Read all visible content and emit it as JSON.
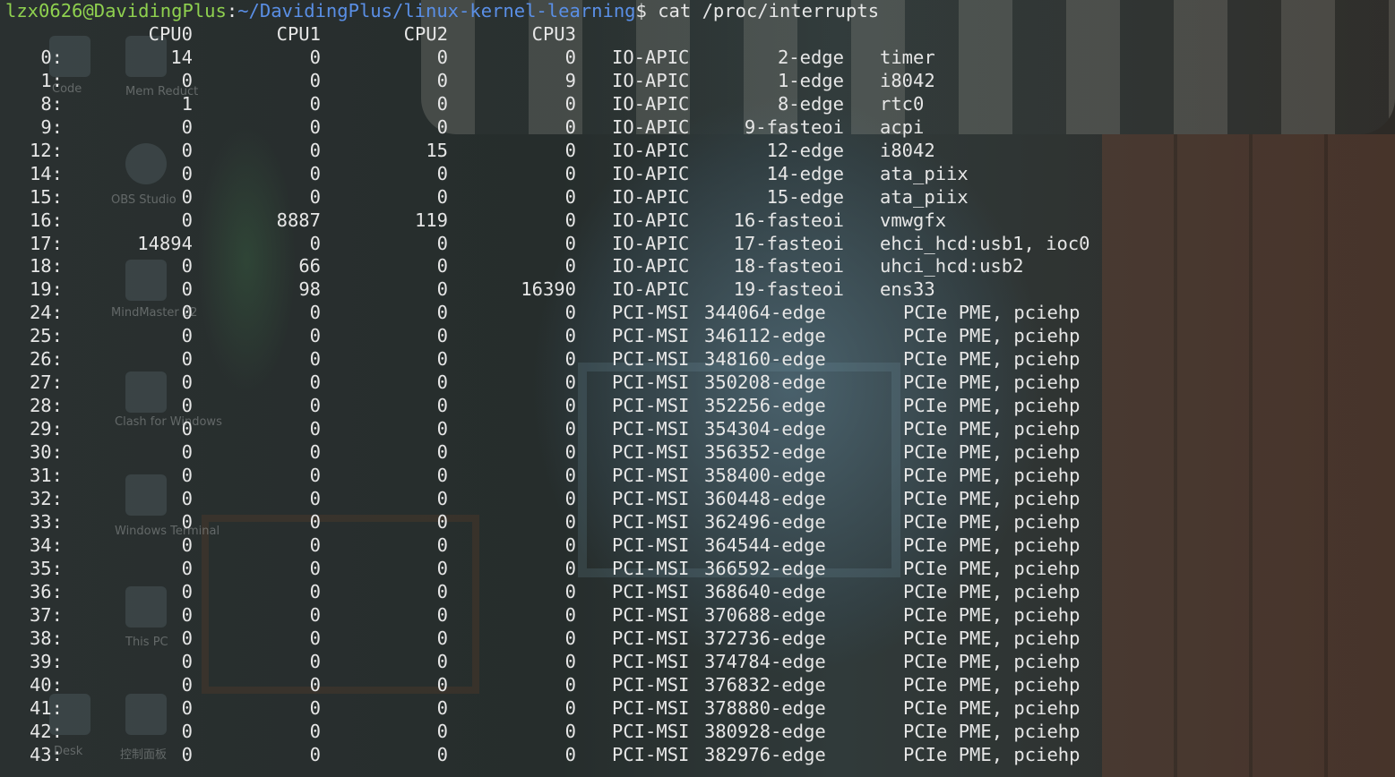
{
  "prompt": {
    "user_host": "lzx0626@DavidingPlus",
    "colon": ":",
    "path": "~/DavidingPlus/linux-kernel-learning",
    "dollar": "$",
    "command": " cat /proc/interrupts"
  },
  "header": [
    "CPU0",
    "CPU1",
    "CPU2",
    "CPU3"
  ],
  "rows": [
    {
      "irq": "0:",
      "cpu0": "14",
      "cpu1": "0",
      "cpu2": "0",
      "cpu3": "0",
      "chip": "IO-APIC",
      "type": "2-edge",
      "device": "timer"
    },
    {
      "irq": "1:",
      "cpu0": "0",
      "cpu1": "0",
      "cpu2": "0",
      "cpu3": "9",
      "chip": "IO-APIC",
      "type": "1-edge",
      "device": "i8042"
    },
    {
      "irq": "8:",
      "cpu0": "1",
      "cpu1": "0",
      "cpu2": "0",
      "cpu3": "0",
      "chip": "IO-APIC",
      "type": "8-edge",
      "device": "rtc0"
    },
    {
      "irq": "9:",
      "cpu0": "0",
      "cpu1": "0",
      "cpu2": "0",
      "cpu3": "0",
      "chip": "IO-APIC",
      "type": "9-fasteoi",
      "device": "acpi"
    },
    {
      "irq": "12:",
      "cpu0": "0",
      "cpu1": "0",
      "cpu2": "15",
      "cpu3": "0",
      "chip": "IO-APIC",
      "type": "12-edge",
      "device": "i8042"
    },
    {
      "irq": "14:",
      "cpu0": "0",
      "cpu1": "0",
      "cpu2": "0",
      "cpu3": "0",
      "chip": "IO-APIC",
      "type": "14-edge",
      "device": "ata_piix"
    },
    {
      "irq": "15:",
      "cpu0": "0",
      "cpu1": "0",
      "cpu2": "0",
      "cpu3": "0",
      "chip": "IO-APIC",
      "type": "15-edge",
      "device": "ata_piix"
    },
    {
      "irq": "16:",
      "cpu0": "0",
      "cpu1": "8887",
      "cpu2": "119",
      "cpu3": "0",
      "chip": "IO-APIC",
      "type": "16-fasteoi",
      "device": "vmwgfx"
    },
    {
      "irq": "17:",
      "cpu0": "14894",
      "cpu1": "0",
      "cpu2": "0",
      "cpu3": "0",
      "chip": "IO-APIC",
      "type": "17-fasteoi",
      "device": "ehci_hcd:usb1, ioc0"
    },
    {
      "irq": "18:",
      "cpu0": "0",
      "cpu1": "66",
      "cpu2": "0",
      "cpu3": "0",
      "chip": "IO-APIC",
      "type": "18-fasteoi",
      "device": "uhci_hcd:usb2"
    },
    {
      "irq": "19:",
      "cpu0": "0",
      "cpu1": "98",
      "cpu2": "0",
      "cpu3": "16390",
      "chip": "IO-APIC",
      "type": "19-fasteoi",
      "device": "ens33"
    },
    {
      "irq": "24:",
      "cpu0": "0",
      "cpu1": "0",
      "cpu2": "0",
      "cpu3": "0",
      "chip": "PCI-MSI",
      "type": "344064-edge",
      "device": "PCIe PME, pciehp"
    },
    {
      "irq": "25:",
      "cpu0": "0",
      "cpu1": "0",
      "cpu2": "0",
      "cpu3": "0",
      "chip": "PCI-MSI",
      "type": "346112-edge",
      "device": "PCIe PME, pciehp"
    },
    {
      "irq": "26:",
      "cpu0": "0",
      "cpu1": "0",
      "cpu2": "0",
      "cpu3": "0",
      "chip": "PCI-MSI",
      "type": "348160-edge",
      "device": "PCIe PME, pciehp"
    },
    {
      "irq": "27:",
      "cpu0": "0",
      "cpu1": "0",
      "cpu2": "0",
      "cpu3": "0",
      "chip": "PCI-MSI",
      "type": "350208-edge",
      "device": "PCIe PME, pciehp"
    },
    {
      "irq": "28:",
      "cpu0": "0",
      "cpu1": "0",
      "cpu2": "0",
      "cpu3": "0",
      "chip": "PCI-MSI",
      "type": "352256-edge",
      "device": "PCIe PME, pciehp"
    },
    {
      "irq": "29:",
      "cpu0": "0",
      "cpu1": "0",
      "cpu2": "0",
      "cpu3": "0",
      "chip": "PCI-MSI",
      "type": "354304-edge",
      "device": "PCIe PME, pciehp"
    },
    {
      "irq": "30:",
      "cpu0": "0",
      "cpu1": "0",
      "cpu2": "0",
      "cpu3": "0",
      "chip": "PCI-MSI",
      "type": "356352-edge",
      "device": "PCIe PME, pciehp"
    },
    {
      "irq": "31:",
      "cpu0": "0",
      "cpu1": "0",
      "cpu2": "0",
      "cpu3": "0",
      "chip": "PCI-MSI",
      "type": "358400-edge",
      "device": "PCIe PME, pciehp"
    },
    {
      "irq": "32:",
      "cpu0": "0",
      "cpu1": "0",
      "cpu2": "0",
      "cpu3": "0",
      "chip": "PCI-MSI",
      "type": "360448-edge",
      "device": "PCIe PME, pciehp"
    },
    {
      "irq": "33:",
      "cpu0": "0",
      "cpu1": "0",
      "cpu2": "0",
      "cpu3": "0",
      "chip": "PCI-MSI",
      "type": "362496-edge",
      "device": "PCIe PME, pciehp"
    },
    {
      "irq": "34:",
      "cpu0": "0",
      "cpu1": "0",
      "cpu2": "0",
      "cpu3": "0",
      "chip": "PCI-MSI",
      "type": "364544-edge",
      "device": "PCIe PME, pciehp"
    },
    {
      "irq": "35:",
      "cpu0": "0",
      "cpu1": "0",
      "cpu2": "0",
      "cpu3": "0",
      "chip": "PCI-MSI",
      "type": "366592-edge",
      "device": "PCIe PME, pciehp"
    },
    {
      "irq": "36:",
      "cpu0": "0",
      "cpu1": "0",
      "cpu2": "0",
      "cpu3": "0",
      "chip": "PCI-MSI",
      "type": "368640-edge",
      "device": "PCIe PME, pciehp"
    },
    {
      "irq": "37:",
      "cpu0": "0",
      "cpu1": "0",
      "cpu2": "0",
      "cpu3": "0",
      "chip": "PCI-MSI",
      "type": "370688-edge",
      "device": "PCIe PME, pciehp"
    },
    {
      "irq": "38:",
      "cpu0": "0",
      "cpu1": "0",
      "cpu2": "0",
      "cpu3": "0",
      "chip": "PCI-MSI",
      "type": "372736-edge",
      "device": "PCIe PME, pciehp"
    },
    {
      "irq": "39:",
      "cpu0": "0",
      "cpu1": "0",
      "cpu2": "0",
      "cpu3": "0",
      "chip": "PCI-MSI",
      "type": "374784-edge",
      "device": "PCIe PME, pciehp"
    },
    {
      "irq": "40:",
      "cpu0": "0",
      "cpu1": "0",
      "cpu2": "0",
      "cpu3": "0",
      "chip": "PCI-MSI",
      "type": "376832-edge",
      "device": "PCIe PME, pciehp"
    },
    {
      "irq": "41:",
      "cpu0": "0",
      "cpu1": "0",
      "cpu2": "0",
      "cpu3": "0",
      "chip": "PCI-MSI",
      "type": "378880-edge",
      "device": "PCIe PME, pciehp"
    },
    {
      "irq": "42:",
      "cpu0": "0",
      "cpu1": "0",
      "cpu2": "0",
      "cpu3": "0",
      "chip": "PCI-MSI",
      "type": "380928-edge",
      "device": "PCIe PME, pciehp"
    },
    {
      "irq": "43:",
      "cpu0": "0",
      "cpu1": "0",
      "cpu2": "0",
      "cpu3": "0",
      "chip": "PCI-MSI",
      "type": "382976-edge",
      "device": "PCIe PME, pciehp"
    }
  ],
  "desktop_labels": [
    "Code",
    "Mem Reduct",
    "OBS Studio",
    "MindMaster 22",
    "Clash for Windows",
    "Windows Terminal",
    "This PC",
    "控制面板",
    "Desk"
  ],
  "colors": {
    "prompt_user": "#8fd14f",
    "prompt_path": "#5a8fe6",
    "text": "#e6e6e6"
  }
}
